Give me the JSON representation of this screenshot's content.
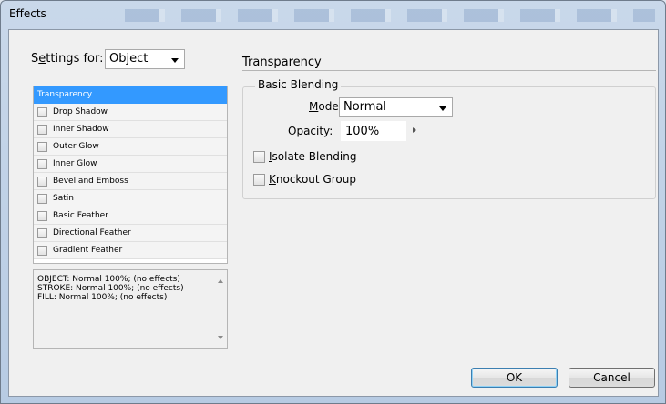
{
  "window": {
    "title": "Effects"
  },
  "settings": {
    "label_pre": "S",
    "label_ul": "e",
    "label_post": "ttings for:",
    "value": "Object"
  },
  "effects_list": [
    {
      "label": "Transparency",
      "selected": true,
      "has_checkbox": false
    },
    {
      "label": "Drop Shadow",
      "selected": false,
      "has_checkbox": true,
      "checked": false
    },
    {
      "label": "Inner Shadow",
      "selected": false,
      "has_checkbox": true,
      "checked": false
    },
    {
      "label": "Outer Glow",
      "selected": false,
      "has_checkbox": true,
      "checked": false
    },
    {
      "label": "Inner Glow",
      "selected": false,
      "has_checkbox": true,
      "checked": false
    },
    {
      "label": "Bevel and Emboss",
      "selected": false,
      "has_checkbox": true,
      "checked": false
    },
    {
      "label": "Satin",
      "selected": false,
      "has_checkbox": true,
      "checked": false
    },
    {
      "label": "Basic Feather",
      "selected": false,
      "has_checkbox": true,
      "checked": false
    },
    {
      "label": "Directional Feather",
      "selected": false,
      "has_checkbox": true,
      "checked": false
    },
    {
      "label": "Gradient Feather",
      "selected": false,
      "has_checkbox": true,
      "checked": false
    }
  ],
  "summary": [
    "OBJECT: Normal 100%; (no effects)",
    "STROKE: Normal 100%; (no effects)",
    "FILL: Normal 100%; (no effects)"
  ],
  "transparency": {
    "section_title": "Transparency",
    "group_title": "Basic Blending",
    "mode_label_ul": "M",
    "mode_label_post": "ode:",
    "mode_value": "Normal",
    "opacity_label_ul": "O",
    "opacity_label_post": "pacity:",
    "opacity_value": "100%",
    "isolate_label_ul": "I",
    "isolate_label_post": "solate Blending",
    "isolate_checked": false,
    "knockout_label_ul": "K",
    "knockout_label_post": "nockout Group",
    "knockout_checked": false
  },
  "buttons": {
    "ok": "OK",
    "cancel": "Cancel"
  },
  "colors": {
    "selection": "#3399ff",
    "window_frame": "#b7cbe3",
    "dialog_bg": "#f0f0f0"
  }
}
